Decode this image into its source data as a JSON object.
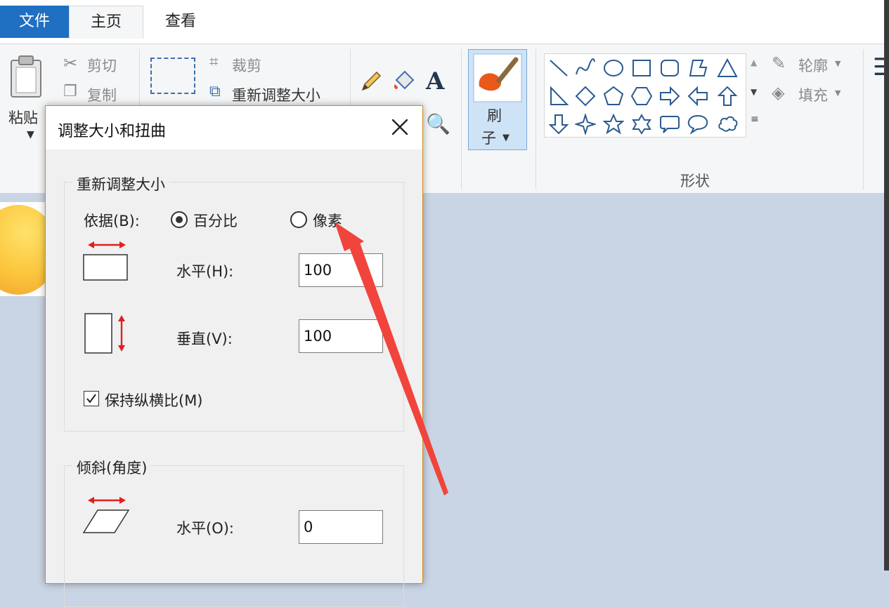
{
  "tabs": {
    "file": "文件",
    "home": "主页",
    "view": "查看"
  },
  "clipboard": {
    "paste": "粘贴",
    "cut": "剪切",
    "copy": "复制"
  },
  "image": {
    "crop": "裁剪",
    "resize": "重新调整大小"
  },
  "brush": {
    "label_line1": "刷",
    "label_line2": "子"
  },
  "shapes": {
    "group_label": "形状",
    "outline": "轮廓",
    "fill": "填充"
  },
  "dialog": {
    "title": "调整大小和扭曲",
    "resize_group": "重新调整大小",
    "by_label": "依据(B):",
    "option_percent": "百分比",
    "option_pixels": "像素",
    "selected_option": "百分比",
    "horizontal_label": "水平(H):",
    "horizontal_value": "100",
    "vertical_label": "垂直(V):",
    "vertical_value": "100",
    "keep_ratio_label": "保持纵横比(M)",
    "keep_ratio_checked": true,
    "skew_group": "倾斜(角度)",
    "skew_horizontal_label": "水平(O):",
    "skew_horizontal_value": "0"
  },
  "colors": {
    "file_tab": "#1f6fc2",
    "annotation_arrow": "#f0443c",
    "dialog_border": "#d28c28",
    "resize_arrow": "#e02020",
    "canvas_bg": "#c9d4e4"
  }
}
